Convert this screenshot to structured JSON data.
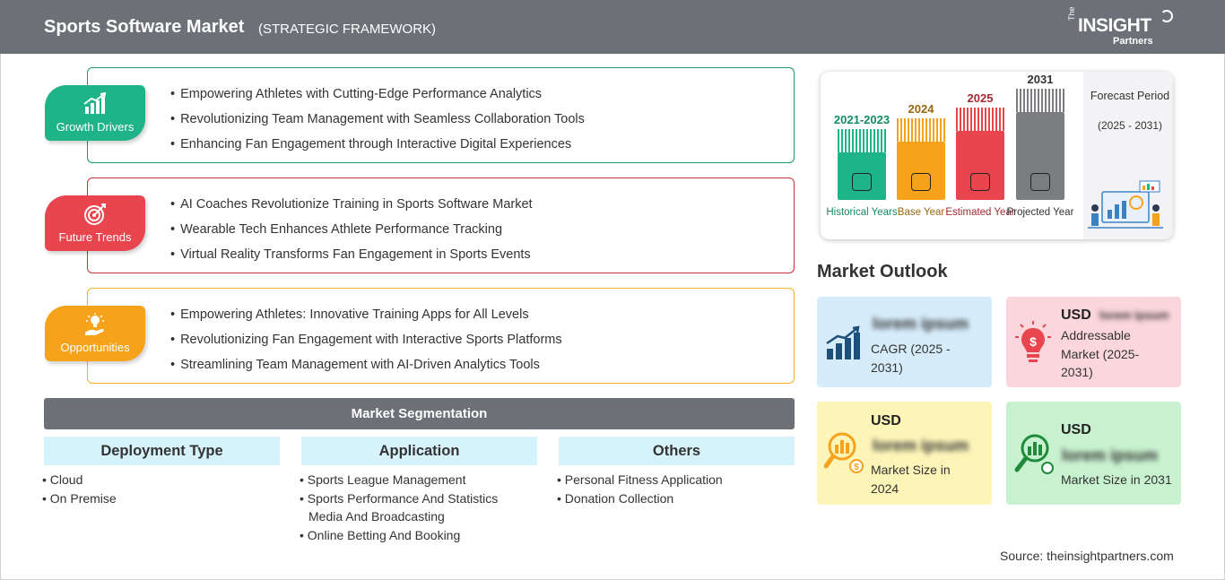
{
  "header": {
    "title": "Sports Software Market",
    "subtitle": "(STRATEGIC FRAMEWORK)",
    "logo": {
      "the": "The",
      "insight": "INSIGHT",
      "partners": "Partners"
    }
  },
  "framework": [
    {
      "badge": "Growth Drivers",
      "color": "#1fb487",
      "border": "#1a9a73",
      "icon": "bar-chart-up-icon",
      "items": [
        "Empowering Athletes with Cutting-Edge Performance Analytics",
        "Revolutionizing Team Management with Seamless Collaboration Tools",
        "Enhancing Fan Engagement through Interactive Digital Experiences"
      ]
    },
    {
      "badge": "Future Trends",
      "color": "#e8454f",
      "border": "#c8313c",
      "icon": "target-icon",
      "items": [
        "AI Coaches Revolutionize Training in Sports Software Market",
        "Wearable Tech Enhances Athlete Performance Tracking",
        "Virtual Reality Transforms Fan Engagement in Sports Events"
      ]
    },
    {
      "badge": "Opportunities",
      "color": "#f7a21b",
      "border": "#f0b429",
      "icon": "lightbulb-hand-icon",
      "items": [
        "Empowering Athletes: Innovative Training Apps for All Levels",
        "Revolutionizing Fan Engagement with Interactive Sports Platforms",
        "Streamlining Team Management with AI-Driven Analytics Tools"
      ]
    }
  ],
  "segmentation": {
    "title": "Market Segmentation",
    "columns": [
      {
        "heading": "Deployment Type",
        "items": [
          "Cloud",
          "On Premise"
        ]
      },
      {
        "heading": "Application",
        "items": [
          "Sports League Management",
          "Sports Performance And Statistics",
          "Media And Broadcasting",
          "Online Betting And Booking"
        ]
      },
      {
        "heading": "Others",
        "items": [
          "Personal Fitness Application",
          "Donation Collection"
        ]
      }
    ]
  },
  "timeline": {
    "forecast_title": "Forecast Period",
    "forecast_range": "(2025 - 2031)",
    "stages": [
      {
        "year": "2021-2023",
        "label": "Historical Years",
        "color": "#1fb487",
        "year_color": "#148a66",
        "icon": "history-clock-icon"
      },
      {
        "year": "2024",
        "label": "Base Year",
        "color": "#f7a21b",
        "year_color": "#9a6512",
        "icon": "calendar-icon"
      },
      {
        "year": "2025",
        "label": "Estimated Year",
        "color": "#e8454f",
        "year_color": "#a52a33",
        "icon": "estimate-gears-icon"
      },
      {
        "year": "2031",
        "label": "Projected Year",
        "color": "#7b7d80",
        "year_color": "#333333",
        "icon": "presentation-board-icon"
      }
    ]
  },
  "outlook": {
    "title": "Market Outlook",
    "boxes": [
      {
        "bg": "#d6ecfa",
        "usd": "",
        "value": "lorem ipsum",
        "text": "CAGR (2025 - 2031)",
        "icon": "growth-chart-icon"
      },
      {
        "bg": "#fbd6dc",
        "usd": "USD",
        "value": "lorem ipsum",
        "text": "Addressable Market (2025-2031)",
        "icon": "dollar-bulb-icon"
      },
      {
        "bg": "#fdf5b8",
        "usd": "USD",
        "value": "lorem ipsum",
        "text": "Market Size in 2024",
        "icon": "magnifier-coins-icon"
      },
      {
        "bg": "#c8f2cf",
        "usd": "USD",
        "value": "lorem ipsum",
        "text": "Market Size in 2031",
        "icon": "magnifier-chart-icon"
      }
    ]
  },
  "source": "Source: theinsightpartners.com"
}
